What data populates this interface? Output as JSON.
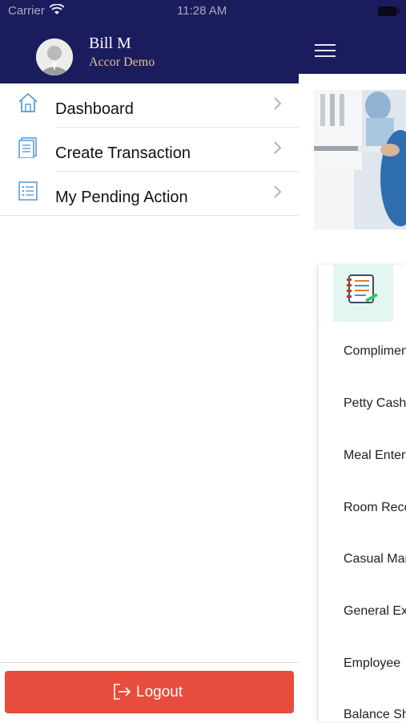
{
  "status_bar": {
    "carrier": "Carrier",
    "time": "11:28 AM"
  },
  "user": {
    "name": "Bill M",
    "org": "Accor Demo"
  },
  "menu": [
    {
      "label": "Dashboard",
      "icon": "home-icon"
    },
    {
      "label": "Create Transaction",
      "icon": "document-icon"
    },
    {
      "label": "My Pending Action",
      "icon": "list-icon"
    }
  ],
  "logout": {
    "label": "Logout",
    "icon": "logout-icon"
  },
  "main": {
    "forms": [
      "Complimentary",
      "Petty Cash",
      "Meal Entertainment",
      "Room Recovery",
      "Casual Manpower",
      "General Expense",
      "Employee",
      "Balance Sheet"
    ]
  },
  "colors": {
    "header": "#1b1c5e",
    "accent_gold": "#e0c28a",
    "logout": "#e74c3c",
    "icon_blue": "#5a9ed6"
  }
}
